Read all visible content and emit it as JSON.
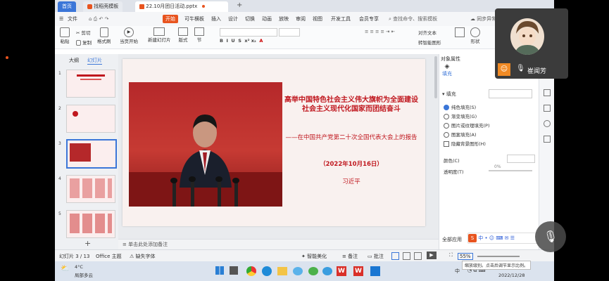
{
  "tabs": {
    "home": "首页",
    "template": "找稻壳模板",
    "doc": "22.10月团日活动.pptx",
    "add": "+"
  },
  "menu": {
    "file": "文件",
    "start": "开始",
    "items": [
      "可牛横板",
      "插入",
      "设计",
      "切换",
      "动画",
      "放映",
      "审阅",
      "视图",
      "开发工具",
      "会员专享"
    ],
    "search": "查找命令、搜索模板",
    "sync": "同步异常",
    "share": "分享"
  },
  "ribbon": {
    "paste": "粘贴",
    "cut": "剪切",
    "copy": "复制",
    "format_painter": "格式刷",
    "play": "当页开始",
    "new_slide": "新建幻灯片",
    "layout": "版式",
    "section": "节",
    "reset": "重置",
    "arrange": "对齐文本",
    "convert": "转智能图形",
    "shape": "形状"
  },
  "panel_tabs": {
    "outline": "大纲",
    "slides": "幻灯片"
  },
  "thumb_numbers": [
    "1",
    "2",
    "3",
    "4",
    "5"
  ],
  "slide": {
    "title": "高举中国特色社会主义伟大旗帜为全面建设社会主义现代化国家而团结奋斗",
    "subtitle": "——在中国共产党第二十次全国代表大会上的报告",
    "date": "（2022年10月16日）",
    "author": "习近平"
  },
  "notes": {
    "placeholder": "单击此处添加备注"
  },
  "right_panel": {
    "header": "对象属性",
    "tab": "填充",
    "section": "填充",
    "options": [
      "纯色填充(S)",
      "渐变填充(G)",
      "图片或纹理填充(P)",
      "图案填充(A)",
      "隐藏背景图形(H)"
    ],
    "color_label": "颜色(C)",
    "transparency_label": "透明度(T)",
    "transparency_value": "0%",
    "apply_all": "全部应用"
  },
  "status": {
    "slide_count": "幻灯片 3 / 13",
    "theme": "Office 主题",
    "missing_font": "缺失字体",
    "beautify": "智能美化",
    "notes": "备注",
    "comments": "批注",
    "zoom": "55%",
    "zoom_tip": "缩放级别。点击后调节显示比例。"
  },
  "taskbar": {
    "temp": "4°C",
    "weather": "局部多云",
    "time": "2022/12/28",
    "lang": "中"
  },
  "video": {
    "name": "崔闻芳"
  },
  "colors": {
    "accent": "#c0171e",
    "wps_orange": "#e8541f",
    "select_blue": "#3b76d8"
  }
}
